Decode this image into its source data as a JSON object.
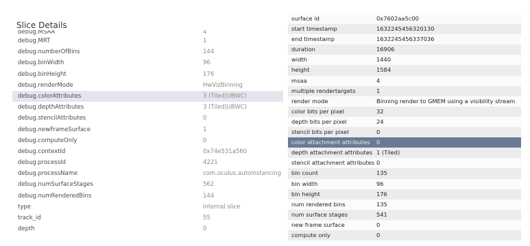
{
  "left_panel": {
    "title": "Slice Details",
    "rows": [
      {
        "key": "debug.MSAA",
        "value": "4"
      },
      {
        "key": "debug.MRT",
        "value": "1"
      },
      {
        "key": "debug.numberOfBins",
        "value": "144"
      },
      {
        "key": "debug.binWidth",
        "value": "96"
      },
      {
        "key": "debug.binHeight",
        "value": "176"
      },
      {
        "key": "debug.renderMode",
        "value": "HwVizBinning"
      },
      {
        "key": "debug.colorAttributes",
        "value": "3 (Tiled|UBWC)"
      },
      {
        "key": "debug.depthAttributes",
        "value": "3 (Tiled|UBWC)"
      },
      {
        "key": "debug.stencilAttributes",
        "value": "0"
      },
      {
        "key": "debug.newFrameSurface",
        "value": "1"
      },
      {
        "key": "debug.computeOnly",
        "value": "0"
      },
      {
        "key": "debug.contextId",
        "value": "0x74e531a560"
      },
      {
        "key": "debug.processId",
        "value": "4221"
      },
      {
        "key": "debug.processName",
        "value": "com.oculus.autoinstancing"
      },
      {
        "key": "debug.numSurfaceStages",
        "value": "562"
      },
      {
        "key": "debug.numRenderedBins",
        "value": "144"
      },
      {
        "key": "type",
        "value": "internal slice"
      },
      {
        "key": "track_id",
        "value": "55"
      },
      {
        "key": "depth",
        "value": "0"
      }
    ]
  },
  "right_panel": {
    "rows": [
      {
        "key": "surface id",
        "value": "0x7602aa5c00"
      },
      {
        "key": "start timestamp",
        "value": "1632245456320130"
      },
      {
        "key": "end timestamp",
        "value": "1632245456337036"
      },
      {
        "key": "duration",
        "value": "16906"
      },
      {
        "key": "width",
        "value": "1440"
      },
      {
        "key": "height",
        "value": "1584"
      },
      {
        "key": "msaa",
        "value": "4"
      },
      {
        "key": "multiple rendertargets",
        "value": "1"
      },
      {
        "key": "render mode",
        "value": "Binning render to GMEM using a visibility stream"
      },
      {
        "key": "color bits per pixel",
        "value": "32"
      },
      {
        "key": "depth bits per pixel",
        "value": "24"
      },
      {
        "key": "stencil bits per pixel",
        "value": "0"
      },
      {
        "key": "color attachment attributes",
        "value": "0"
      },
      {
        "key": "depth attachment attributes",
        "value": "1 (Tiled)"
      },
      {
        "key": "stencil attachment attributes",
        "value": "0"
      },
      {
        "key": "bin count",
        "value": "135"
      },
      {
        "key": "bin width",
        "value": "96"
      },
      {
        "key": "bin height",
        "value": "176"
      },
      {
        "key": "num rendered bins",
        "value": "135"
      },
      {
        "key": "num surface stages",
        "value": "541"
      },
      {
        "key": "new frame surface",
        "value": "0"
      },
      {
        "key": "compute only",
        "value": "0"
      }
    ]
  },
  "colors": {
    "selected_row": "#e3e6ec",
    "highlight_row": "#6a7a92",
    "stripe": "#ececec"
  }
}
